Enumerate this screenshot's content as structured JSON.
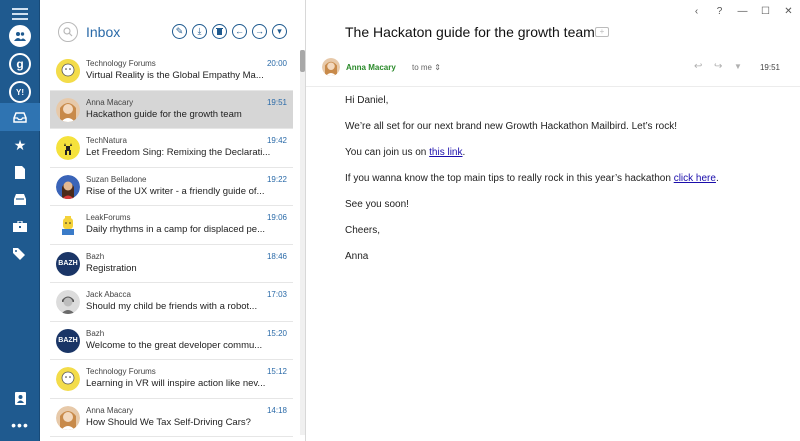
{
  "rail": {
    "accounts": [
      {
        "icon": "contacts-icon",
        "glyph": "👥"
      },
      {
        "icon": "google-account-icon",
        "glyph": "g"
      },
      {
        "icon": "yahoo-account-icon",
        "glyph": "Y!"
      }
    ],
    "nav": [
      {
        "icon": "inbox-icon",
        "glyph": "📥",
        "active": true
      },
      {
        "icon": "star-icon",
        "glyph": "★",
        "active": false
      },
      {
        "icon": "document-icon",
        "glyph": "📄",
        "active": false
      },
      {
        "icon": "archive-icon",
        "glyph": "🗄",
        "active": false
      },
      {
        "icon": "briefcase-icon",
        "glyph": "💼",
        "active": false
      },
      {
        "icon": "tags-icon",
        "glyph": "🏷",
        "active": false
      }
    ],
    "bottom": {
      "icon": "contacts-book-icon",
      "glyph": "📇"
    },
    "more": "•••"
  },
  "list": {
    "title": "Inbox",
    "toolbar": [
      {
        "icon": "compose-icon",
        "glyph": "✎"
      },
      {
        "icon": "download-icon",
        "glyph": "⤓"
      },
      {
        "icon": "trash-icon",
        "glyph": "🗑"
      },
      {
        "icon": "reply-icon",
        "glyph": "←"
      },
      {
        "icon": "forward-icon",
        "glyph": "→"
      },
      {
        "icon": "dropdown-icon",
        "glyph": "▾"
      }
    ],
    "messages": [
      {
        "sender": "Technology Forums",
        "time": "20:00",
        "subject": "Virtual Reality is the Global Empathy Ma...",
        "avatar": "yellow",
        "initials": ""
      },
      {
        "sender": "Anna Macary",
        "time": "19:51",
        "subject": "Hackathon guide for the growth team",
        "avatar": "photo-anna",
        "initials": "",
        "selected": true
      },
      {
        "sender": "TechNatura",
        "time": "19:42",
        "subject": "Let Freedom Sing: Remixing the Declarati...",
        "avatar": "yellow-deer",
        "initials": ""
      },
      {
        "sender": "Suzan Belladone",
        "time": "19:22",
        "subject": "Rise of the UX writer - a friendly guide of...",
        "avatar": "photo-suzan",
        "initials": ""
      },
      {
        "sender": "LeakForums",
        "time": "19:06",
        "subject": "Daily rhythms in a camp for displaced pe...",
        "avatar": "lego",
        "initials": ""
      },
      {
        "sender": "Bazh",
        "time": "18:46",
        "subject": "Registration",
        "avatar": "navy",
        "initials": "BAZH"
      },
      {
        "sender": "Jack Abacca",
        "time": "17:03",
        "subject": "Should my child be friends with a robot...",
        "avatar": "photo-jack",
        "initials": ""
      },
      {
        "sender": "Bazh",
        "time": "15:20",
        "subject": "Welcome to the great developer commu...",
        "avatar": "navy",
        "initials": "BAZH"
      },
      {
        "sender": "Technology Forums",
        "time": "15:12",
        "subject": "Learning in VR will inspire action like nev...",
        "avatar": "yellow",
        "initials": ""
      },
      {
        "sender": "Anna Macary",
        "time": "14:18",
        "subject": "How Should We Tax Self-Driving Cars?",
        "avatar": "photo-anna",
        "initials": ""
      }
    ]
  },
  "window": {
    "controls": [
      "‹",
      "?",
      "—",
      "☐",
      "✕"
    ]
  },
  "mail": {
    "subject": "The Hackaton guide for the growth team",
    "from_name": "Anna Macary",
    "to_label": "to me",
    "time": "19:51",
    "body": {
      "greeting": "Hi Daniel,",
      "p1": "We’re all set for our next brand new Growth Hackathon Mailbird. Let’s rock!",
      "p2_before": "You can join us on ",
      "p2_link": "this link",
      "p2_after": ".",
      "p3_before": "If you wanna know the top main tips to really rock in this year’s hackathon ",
      "p3_link": "click here",
      "p3_after": ".",
      "p4": "See you soon!",
      "closing": "Cheers,",
      "signature": "Anna"
    }
  },
  "colors": {
    "rail": "#1f5a8f",
    "accent": "#2a6aa8",
    "sender_green": "#2a8a2a",
    "selected_row": "#d6d6d6"
  }
}
